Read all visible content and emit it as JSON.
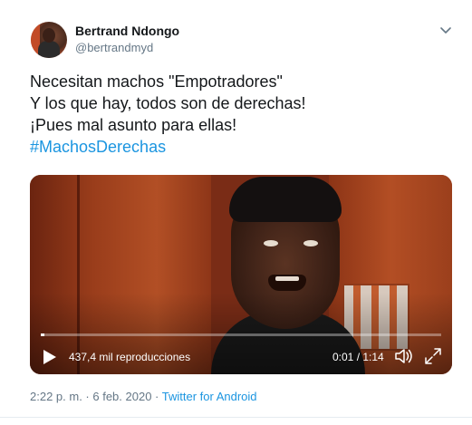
{
  "author": {
    "display_name": "Bertrand Ndongo",
    "handle": "@bertrandmyd"
  },
  "tweet": {
    "lines": [
      "Necesitan machos \"Empotradores\"",
      "Y los que hay, todos son de derechas!",
      "¡Pues mal asunto para ellas!"
    ],
    "hashtag": "#MachosDerechas"
  },
  "video": {
    "views": "437,4 mil reproducciones",
    "time": "0:01 / 1:14",
    "progress_fraction": 0.01
  },
  "meta": {
    "timestamp": "2:22 p. m. · 6 feb. 2020",
    "separator": " · ",
    "source": "Twitter for Android"
  },
  "icons": {
    "menu": "chevron-down-icon",
    "play": "play-icon",
    "volume": "volume-icon",
    "fullscreen": "fullscreen-icon"
  },
  "colors": {
    "link": "#1b95e0",
    "secondary_text": "#657786",
    "primary_text": "#14171a"
  }
}
